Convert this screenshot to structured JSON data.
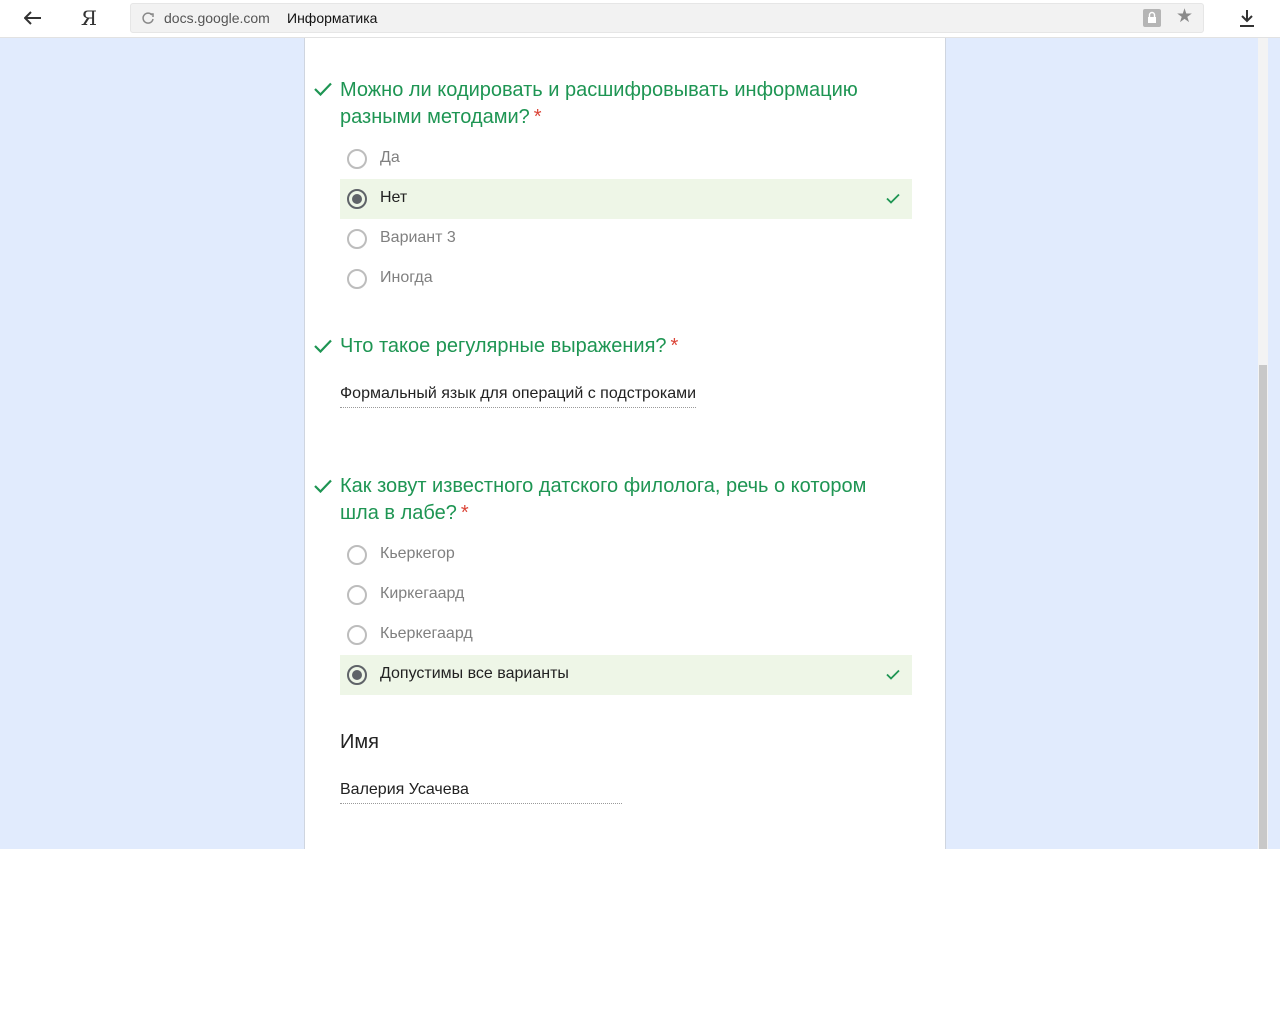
{
  "browser": {
    "domain": "docs.google.com",
    "page_title": "Информатика",
    "yandex_label": "Я"
  },
  "questions": [
    {
      "title": "Можно ли кодировать и расшифровывать информацию разными методами?",
      "required_mark": "*",
      "options": [
        "Да",
        "Нет",
        "Вариант 3",
        "Иногда"
      ],
      "selected": "Нет"
    },
    {
      "title": "Что такое регулярные выражения?",
      "required_mark": "*",
      "answer": "Формальный язык для операций с подстроками"
    },
    {
      "title": "Как зовут известного датского филолога, речь о котором шла в лабе?",
      "required_mark": "*",
      "options": [
        "Кьеркегор",
        "Киркегаард",
        "Кьеркегаард",
        "Допустимы все варианты"
      ],
      "selected": "Допустимы все варианты"
    }
  ],
  "name_field": {
    "label": "Имя",
    "value": "Валерия Усачева"
  },
  "colors": {
    "correct_green": "#1e9553",
    "required_red": "#db4437",
    "selected_bg": "#eef6e7",
    "page_bg": "#e1ebfd"
  }
}
